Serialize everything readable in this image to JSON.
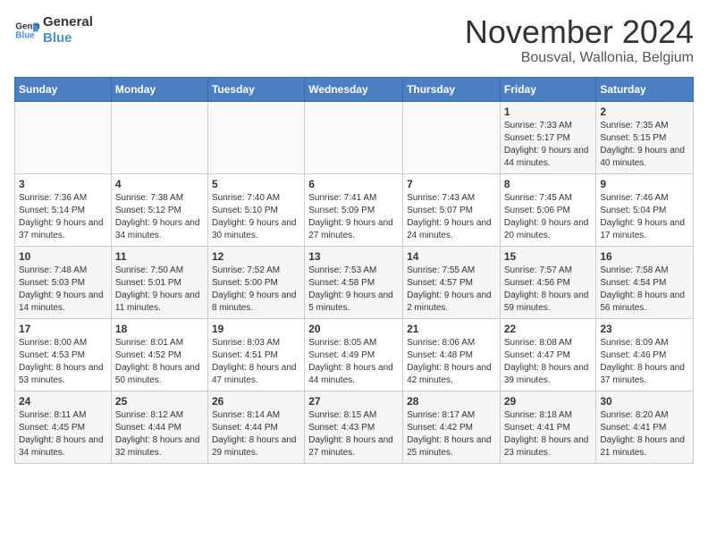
{
  "logo": {
    "line1": "General",
    "line2": "Blue"
  },
  "title": "November 2024",
  "location": "Bousval, Wallonia, Belgium",
  "days_of_week": [
    "Sunday",
    "Monday",
    "Tuesday",
    "Wednesday",
    "Thursday",
    "Friday",
    "Saturday"
  ],
  "weeks": [
    [
      {
        "day": "",
        "info": ""
      },
      {
        "day": "",
        "info": ""
      },
      {
        "day": "",
        "info": ""
      },
      {
        "day": "",
        "info": ""
      },
      {
        "day": "",
        "info": ""
      },
      {
        "day": "1",
        "info": "Sunrise: 7:33 AM\nSunset: 5:17 PM\nDaylight: 9 hours and 44 minutes."
      },
      {
        "day": "2",
        "info": "Sunrise: 7:35 AM\nSunset: 5:15 PM\nDaylight: 9 hours and 40 minutes."
      }
    ],
    [
      {
        "day": "3",
        "info": "Sunrise: 7:36 AM\nSunset: 5:14 PM\nDaylight: 9 hours and 37 minutes."
      },
      {
        "day": "4",
        "info": "Sunrise: 7:38 AM\nSunset: 5:12 PM\nDaylight: 9 hours and 34 minutes."
      },
      {
        "day": "5",
        "info": "Sunrise: 7:40 AM\nSunset: 5:10 PM\nDaylight: 9 hours and 30 minutes."
      },
      {
        "day": "6",
        "info": "Sunrise: 7:41 AM\nSunset: 5:09 PM\nDaylight: 9 hours and 27 minutes."
      },
      {
        "day": "7",
        "info": "Sunrise: 7:43 AM\nSunset: 5:07 PM\nDaylight: 9 hours and 24 minutes."
      },
      {
        "day": "8",
        "info": "Sunrise: 7:45 AM\nSunset: 5:06 PM\nDaylight: 9 hours and 20 minutes."
      },
      {
        "day": "9",
        "info": "Sunrise: 7:46 AM\nSunset: 5:04 PM\nDaylight: 9 hours and 17 minutes."
      }
    ],
    [
      {
        "day": "10",
        "info": "Sunrise: 7:48 AM\nSunset: 5:03 PM\nDaylight: 9 hours and 14 minutes."
      },
      {
        "day": "11",
        "info": "Sunrise: 7:50 AM\nSunset: 5:01 PM\nDaylight: 9 hours and 11 minutes."
      },
      {
        "day": "12",
        "info": "Sunrise: 7:52 AM\nSunset: 5:00 PM\nDaylight: 9 hours and 8 minutes."
      },
      {
        "day": "13",
        "info": "Sunrise: 7:53 AM\nSunset: 4:58 PM\nDaylight: 9 hours and 5 minutes."
      },
      {
        "day": "14",
        "info": "Sunrise: 7:55 AM\nSunset: 4:57 PM\nDaylight: 9 hours and 2 minutes."
      },
      {
        "day": "15",
        "info": "Sunrise: 7:57 AM\nSunset: 4:56 PM\nDaylight: 8 hours and 59 minutes."
      },
      {
        "day": "16",
        "info": "Sunrise: 7:58 AM\nSunset: 4:54 PM\nDaylight: 8 hours and 56 minutes."
      }
    ],
    [
      {
        "day": "17",
        "info": "Sunrise: 8:00 AM\nSunset: 4:53 PM\nDaylight: 8 hours and 53 minutes."
      },
      {
        "day": "18",
        "info": "Sunrise: 8:01 AM\nSunset: 4:52 PM\nDaylight: 8 hours and 50 minutes."
      },
      {
        "day": "19",
        "info": "Sunrise: 8:03 AM\nSunset: 4:51 PM\nDaylight: 8 hours and 47 minutes."
      },
      {
        "day": "20",
        "info": "Sunrise: 8:05 AM\nSunset: 4:49 PM\nDaylight: 8 hours and 44 minutes."
      },
      {
        "day": "21",
        "info": "Sunrise: 8:06 AM\nSunset: 4:48 PM\nDaylight: 8 hours and 42 minutes."
      },
      {
        "day": "22",
        "info": "Sunrise: 8:08 AM\nSunset: 4:47 PM\nDaylight: 8 hours and 39 minutes."
      },
      {
        "day": "23",
        "info": "Sunrise: 8:09 AM\nSunset: 4:46 PM\nDaylight: 8 hours and 37 minutes."
      }
    ],
    [
      {
        "day": "24",
        "info": "Sunrise: 8:11 AM\nSunset: 4:45 PM\nDaylight: 8 hours and 34 minutes."
      },
      {
        "day": "25",
        "info": "Sunrise: 8:12 AM\nSunset: 4:44 PM\nDaylight: 8 hours and 32 minutes."
      },
      {
        "day": "26",
        "info": "Sunrise: 8:14 AM\nSunset: 4:44 PM\nDaylight: 8 hours and 29 minutes."
      },
      {
        "day": "27",
        "info": "Sunrise: 8:15 AM\nSunset: 4:43 PM\nDaylight: 8 hours and 27 minutes."
      },
      {
        "day": "28",
        "info": "Sunrise: 8:17 AM\nSunset: 4:42 PM\nDaylight: 8 hours and 25 minutes."
      },
      {
        "day": "29",
        "info": "Sunrise: 8:18 AM\nSunset: 4:41 PM\nDaylight: 8 hours and 23 minutes."
      },
      {
        "day": "30",
        "info": "Sunrise: 8:20 AM\nSunset: 4:41 PM\nDaylight: 8 hours and 21 minutes."
      }
    ]
  ]
}
